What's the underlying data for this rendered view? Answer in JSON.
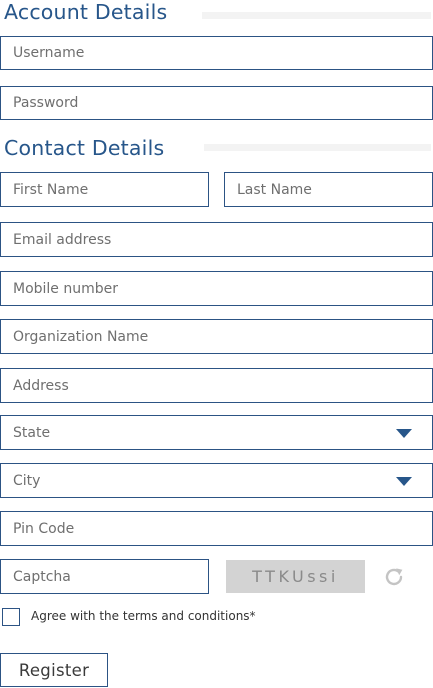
{
  "account": {
    "heading": "Account Details",
    "username_placeholder": "Username",
    "password_placeholder": "Password"
  },
  "contact": {
    "heading": "Contact Details",
    "first_name_placeholder": "First Name",
    "last_name_placeholder": "Last Name",
    "email_placeholder": "Email address",
    "mobile_placeholder": "Mobile number",
    "organization_placeholder": "Organization Name",
    "address_placeholder": "Address",
    "state_selected": "State",
    "city_selected": "City",
    "pin_placeholder": "Pin Code"
  },
  "captcha": {
    "placeholder": "Captcha",
    "code": "TTKUssi",
    "refresh_icon": "refresh-icon"
  },
  "terms": {
    "label": "Agree with the terms and conditions*",
    "checked": false
  },
  "register_label": "Register",
  "colors": {
    "accent": "#27568a",
    "border": "#2c5384",
    "captcha_bg": "#d3d3d3"
  }
}
